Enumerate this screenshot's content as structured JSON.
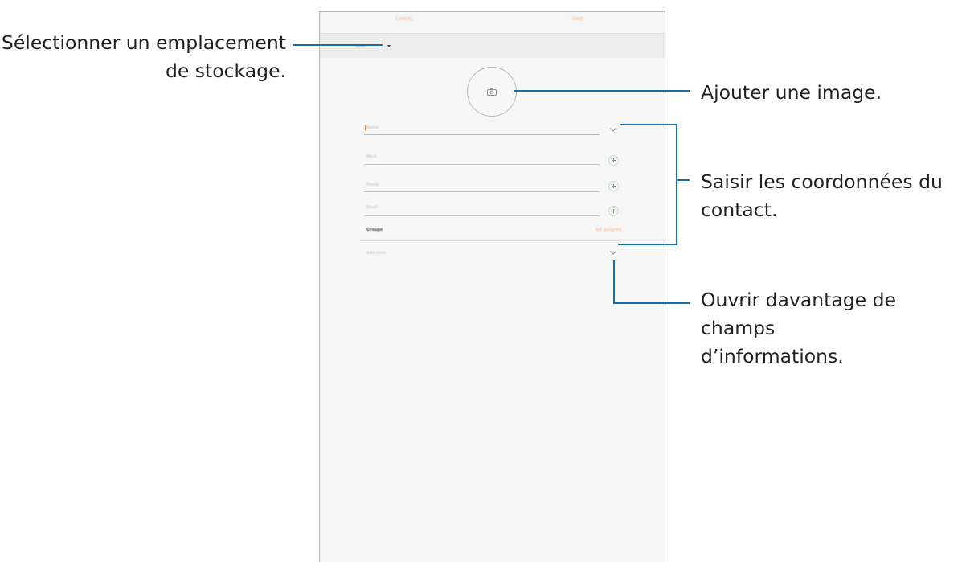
{
  "callouts": {
    "storage": [
      "Sélectionner un emplacement",
      "de stockage."
    ],
    "image": "Ajouter une image.",
    "contact": [
      "Saisir les coordonnées du",
      "contact."
    ],
    "more": [
      "Ouvrir davantage de champs",
      "d’informations."
    ]
  },
  "phone": {
    "topbar": {
      "cancel_label": "CANCEL",
      "save_label": "SAVE"
    },
    "storage": {
      "label": "Tablet"
    },
    "fields": {
      "name_placeholder": "Name",
      "work_placeholder": "Work",
      "phone_placeholder": "Phone",
      "email_placeholder": "Email",
      "groups_label": "Groups",
      "groups_value": "Not assigned",
      "add_more_label": "Add more"
    }
  },
  "colors": {
    "accent": "#f0a87a",
    "callout_line": "#1a6ea4",
    "plus": "#4fa65a",
    "text": "#231f20"
  },
  "icons": [
    "camera-icon",
    "chevron-down-icon",
    "plus-icon",
    "dropdown-arrow-icon"
  ]
}
